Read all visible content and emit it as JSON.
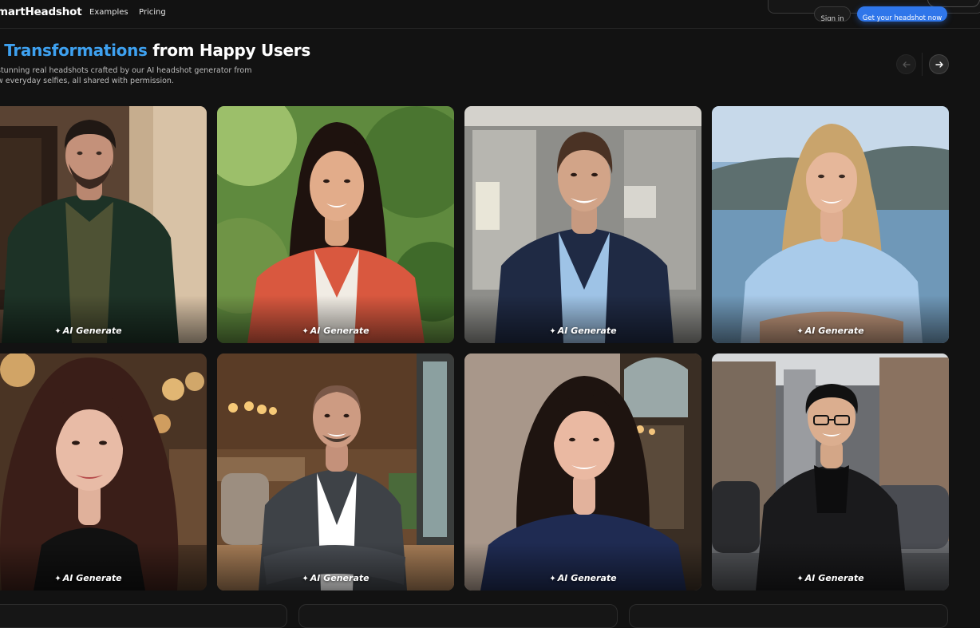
{
  "nav": {
    "brand": "martHeadshot",
    "links": [
      "Examples",
      "Pricing"
    ],
    "signin": "Sign in",
    "cta": "Get your headshot now"
  },
  "hero": {
    "title_highlight": "l Transformations",
    "title_rest": " from Happy Users",
    "subtitle_line1": "stunning real headshots crafted by our AI headshot generator from",
    "subtitle_line2": "w everyday selfies, all shared with permission."
  },
  "carousel": {
    "prev_icon": "arrow-left-icon",
    "next_icon": "arrow-right-icon"
  },
  "cards": [
    {
      "badge": "AI Generate"
    },
    {
      "badge": "AI Generate"
    },
    {
      "badge": "AI Generate"
    },
    {
      "badge": "AI Generate"
    },
    {
      "badge": "AI Generate"
    },
    {
      "badge": "AI Generate"
    },
    {
      "badge": "AI Generate"
    },
    {
      "badge": "AI Generate"
    }
  ],
  "colors": {
    "background": "#121212",
    "accent": "#3ea1f0",
    "cta": "#2f76ea"
  },
  "icons": {
    "badge_icon": "sparkle-icon"
  }
}
